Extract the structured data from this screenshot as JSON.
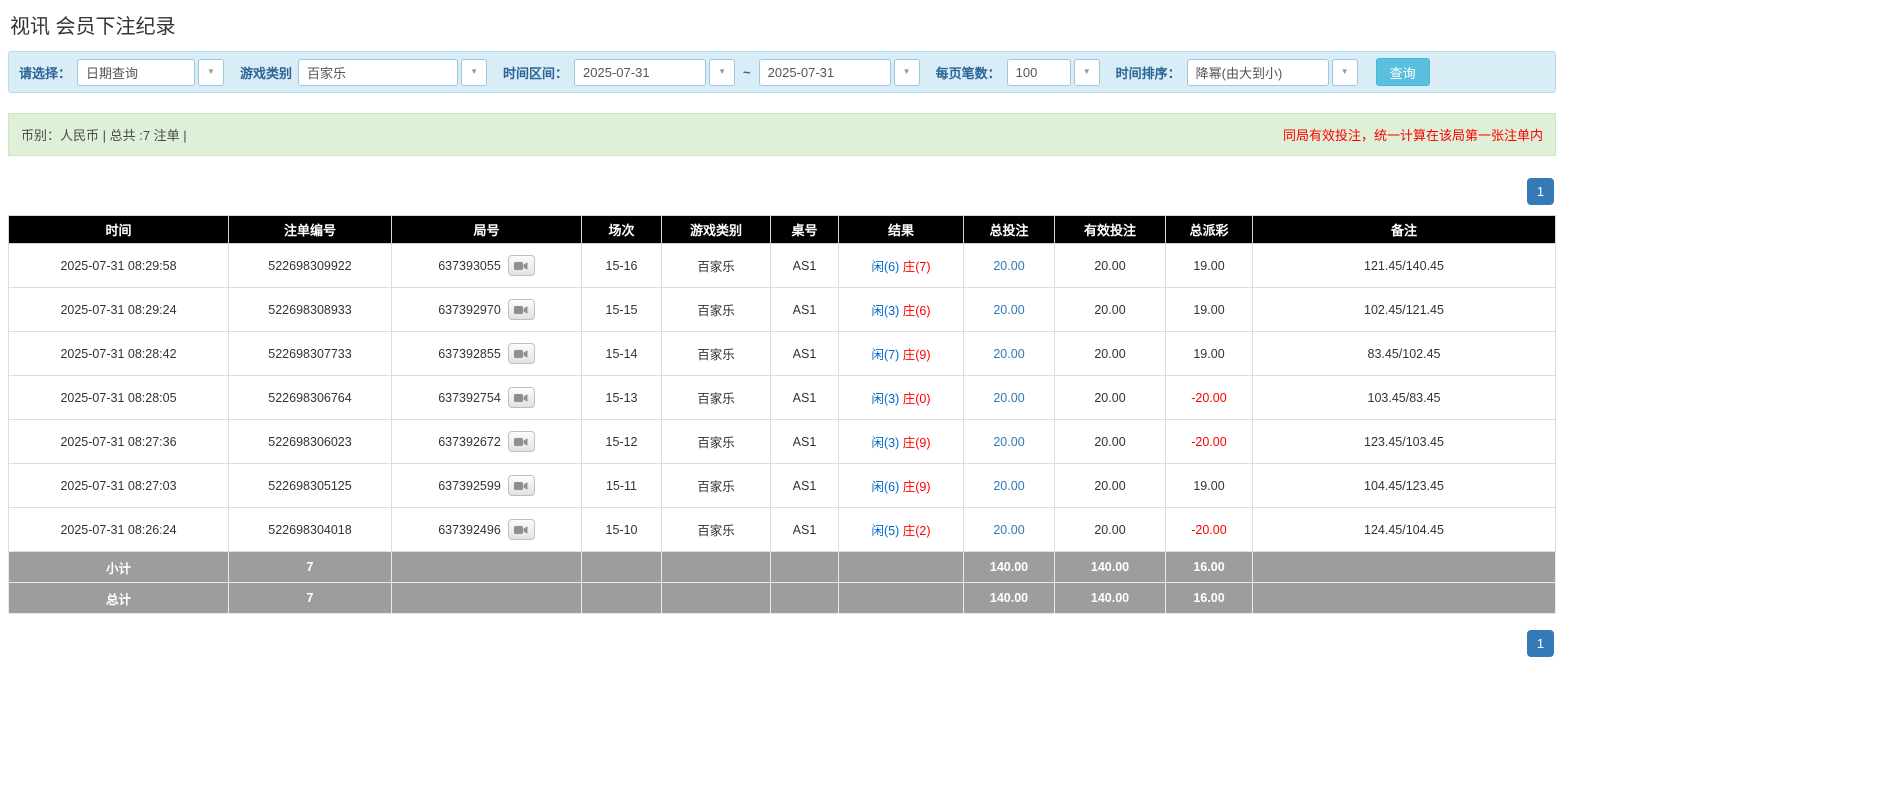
{
  "page": {
    "title": "视讯 会员下注纪录"
  },
  "filters": {
    "select_label": "请选择：",
    "select_value": "日期查询",
    "game_type_label": "游戏类别",
    "game_type_value": "百家乐",
    "date_range_label": "时间区间：",
    "date_from": "2025-07-31",
    "tilde": "~",
    "date_to": "2025-07-31",
    "page_size_label": "每页笔数：",
    "page_size_value": "100",
    "sort_label": "时间排序：",
    "sort_value": "降幂(由大到小)",
    "search_button": "查询"
  },
  "summary": {
    "left": "币别：人民币 | 总共 :7 注单 |",
    "right": "同局有效投注，统一计算在该局第一张注单内"
  },
  "pagination": {
    "page": "1"
  },
  "table": {
    "headers": [
      "时间",
      "注单编号",
      "局号",
      "场次",
      "游戏类别",
      "桌号",
      "结果",
      "总投注",
      "有效投注",
      "总派彩",
      "备注"
    ],
    "rows": [
      {
        "time": "2025-07-31 08:29:58",
        "bet_id": "522698309922",
        "round_id": "637393055",
        "session": "15-16",
        "game": "百家乐",
        "table_no": "AS1",
        "player": "闲(6)",
        "banker": "庄(7)",
        "total_bet": "20.00",
        "valid_bet": "20.00",
        "payout": "19.00",
        "remark": "121.45/140.45"
      },
      {
        "time": "2025-07-31 08:29:24",
        "bet_id": "522698308933",
        "round_id": "637392970",
        "session": "15-15",
        "game": "百家乐",
        "table_no": "AS1",
        "player": "闲(3)",
        "banker": "庄(6)",
        "total_bet": "20.00",
        "valid_bet": "20.00",
        "payout": "19.00",
        "remark": "102.45/121.45"
      },
      {
        "time": "2025-07-31 08:28:42",
        "bet_id": "522698307733",
        "round_id": "637392855",
        "session": "15-14",
        "game": "百家乐",
        "table_no": "AS1",
        "player": "闲(7)",
        "banker": "庄(9)",
        "total_bet": "20.00",
        "valid_bet": "20.00",
        "payout": "19.00",
        "remark": "83.45/102.45"
      },
      {
        "time": "2025-07-31 08:28:05",
        "bet_id": "522698306764",
        "round_id": "637392754",
        "session": "15-13",
        "game": "百家乐",
        "table_no": "AS1",
        "player": "闲(3)",
        "banker": "庄(0)",
        "total_bet": "20.00",
        "valid_bet": "20.00",
        "payout": "-20.00",
        "remark": "103.45/83.45"
      },
      {
        "time": "2025-07-31 08:27:36",
        "bet_id": "522698306023",
        "round_id": "637392672",
        "session": "15-12",
        "game": "百家乐",
        "table_no": "AS1",
        "player": "闲(3)",
        "banker": "庄(9)",
        "total_bet": "20.00",
        "valid_bet": "20.00",
        "payout": "-20.00",
        "remark": "123.45/103.45"
      },
      {
        "time": "2025-07-31 08:27:03",
        "bet_id": "522698305125",
        "round_id": "637392599",
        "session": "15-11",
        "game": "百家乐",
        "table_no": "AS1",
        "player": "闲(6)",
        "banker": "庄(9)",
        "total_bet": "20.00",
        "valid_bet": "20.00",
        "payout": "19.00",
        "remark": "104.45/123.45"
      },
      {
        "time": "2025-07-31 08:26:24",
        "bet_id": "522698304018",
        "round_id": "637392496",
        "session": "15-10",
        "game": "百家乐",
        "table_no": "AS1",
        "player": "闲(5)",
        "banker": "庄(2)",
        "total_bet": "20.00",
        "valid_bet": "20.00",
        "payout": "-20.00",
        "remark": "124.45/104.45"
      }
    ],
    "subtotal": {
      "label": "小计",
      "count": "7",
      "total_bet": "140.00",
      "valid_bet": "140.00",
      "payout": "16.00"
    },
    "total": {
      "label": "总计",
      "count": "7",
      "total_bet": "140.00",
      "valid_bet": "140.00",
      "payout": "16.00"
    }
  },
  "colors": {
    "accent_link": "#337ab7",
    "search_button": "#5bc0de",
    "table_header_bg": "#000000",
    "total_row_bg": "#9d9d9d",
    "player_blue": "#0066cc",
    "banker_red": "#ff0000",
    "negative_red": "#ff0000",
    "filter_bar_bg": "#d9edf7",
    "summary_bar_bg": "#dff0d8"
  }
}
